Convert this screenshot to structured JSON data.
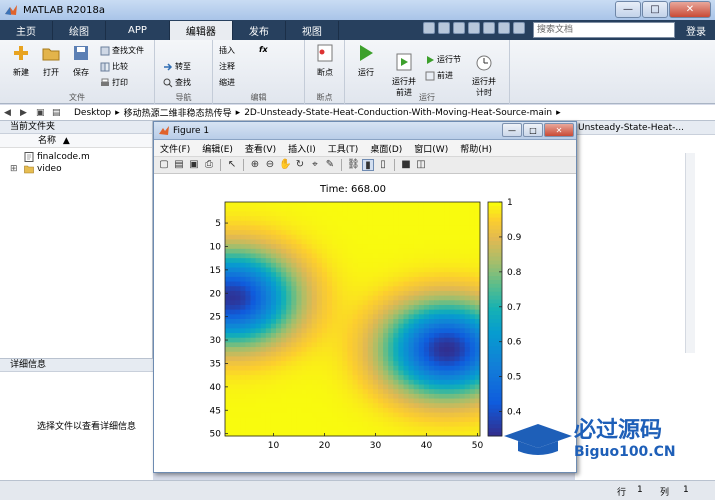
{
  "window": {
    "title": "MATLAB R2018a",
    "controls": [
      "—",
      "□",
      "✕"
    ]
  },
  "tabs": [
    "主页",
    "绘图",
    "APP",
    "编辑器",
    "发布",
    "视图"
  ],
  "active_tab": "编辑器",
  "search": {
    "placeholder": "搜索文档"
  },
  "login": "登录",
  "ribbon": {
    "file_group": {
      "label": "文件",
      "new": "新建",
      "open": "打开",
      "save": "保存",
      "find_files": "查找文件",
      "compare": "比较",
      "print": "打印"
    },
    "nav_group": {
      "label": "导航",
      "goto": "转至",
      "find": "查找"
    },
    "edit_group": {
      "label": "编辑",
      "insert": "插入",
      "comment": "注释",
      "indent": "缩进",
      "fx": "fx"
    },
    "breakpoint_group": {
      "label": "断点",
      "breakpoints": "断点"
    },
    "run_group": {
      "label": "运行",
      "run": "运行",
      "run_advance": "运行并\n前进",
      "run_section": "运行节",
      "advance": "前进",
      "run_time": "运行并\n计时"
    }
  },
  "address": {
    "path": [
      "Desktop",
      "移动热源二维非稳态热传导",
      "2D-Unsteady-State-Heat-Conduction-With-Moving-Heat-Source-main"
    ]
  },
  "current_folder": {
    "title": "当前文件夹",
    "column": "名称",
    "sort_arrow": "▲",
    "files": [
      {
        "name": "finalcode.m",
        "type": "m"
      },
      {
        "name": "video",
        "type": "folder"
      }
    ]
  },
  "details": {
    "title": "详细信息",
    "message": "选择文件以查看详细信息"
  },
  "editor_tab": "Unsteady-State-Heat-...",
  "figure": {
    "title": "Figure 1",
    "menu": [
      "文件(F)",
      "编辑(E)",
      "查看(V)",
      "插入(I)",
      "工具(T)",
      "桌面(D)",
      "窗口(W)",
      "帮助(H)"
    ]
  },
  "statusbar": {
    "row_label": "行",
    "row": "1",
    "col_label": "列",
    "col": "1"
  },
  "watermark": {
    "brand": "必过源码",
    "site": "Biguo100.CN"
  },
  "chart_data": {
    "type": "heatmap",
    "title": "Time: 668.00",
    "xlabel": "",
    "ylabel": "",
    "xlim": [
      1,
      50
    ],
    "ylim": [
      1,
      50
    ],
    "xticks": [
      10,
      20,
      30,
      40,
      50
    ],
    "yticks": [
      5,
      10,
      15,
      20,
      25,
      30,
      35,
      40,
      45,
      50
    ],
    "colorbar": {
      "min": 0.33,
      "max": 1.0,
      "ticks": [
        0.4,
        0.5,
        0.6,
        0.7,
        0.8,
        0.9,
        1
      ]
    },
    "colormap": "parula",
    "features": [
      {
        "kind": "cold-spot",
        "x": 2,
        "y": 21,
        "value": 0.35
      },
      {
        "kind": "cold-spot",
        "x": 44,
        "y": 32,
        "value": 0.34
      },
      {
        "kind": "hot-region",
        "x": 25,
        "y": 6,
        "value": 1.0
      },
      {
        "kind": "hot-region",
        "x": 25,
        "y": 47,
        "value": 1.0
      }
    ]
  }
}
